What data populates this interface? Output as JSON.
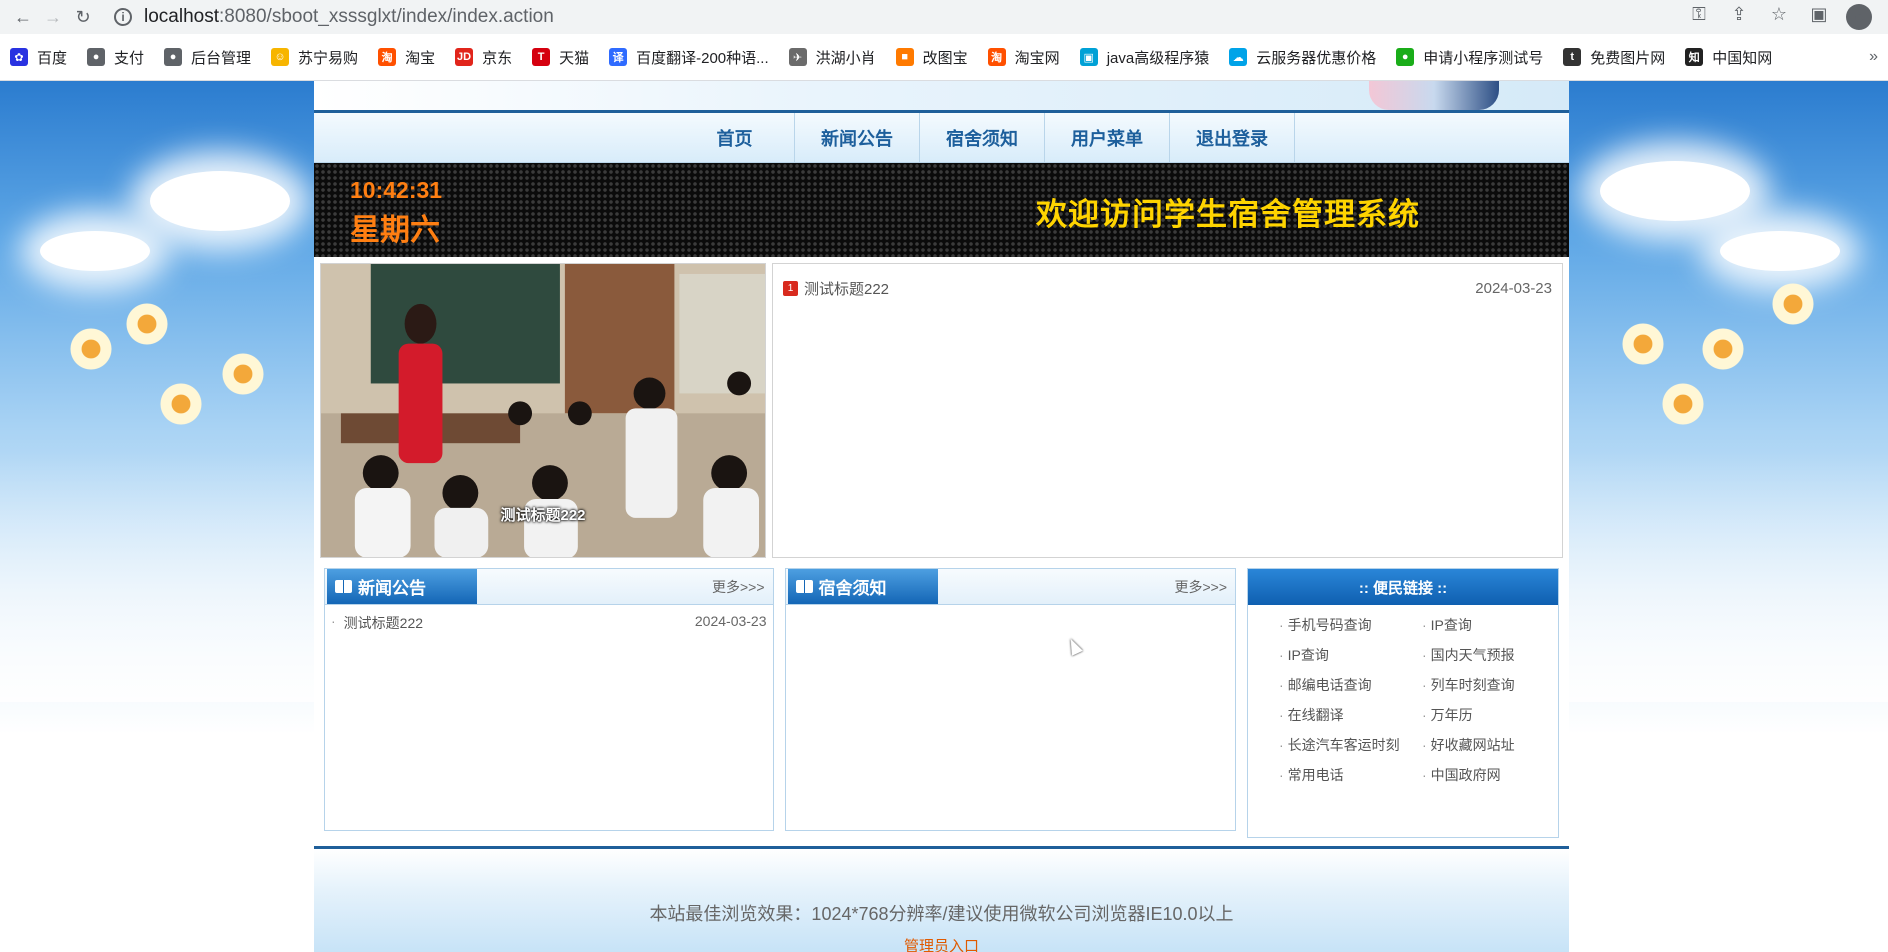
{
  "browser": {
    "url_host": "localhost",
    "url_path": ":8080/sboot_xsssglxt/index/index.action",
    "bookmarks": [
      {
        "label": "百度",
        "icon": "baidu-icon",
        "color": "#2932e1",
        "glyph": "✿"
      },
      {
        "label": "支付",
        "icon": "globe-icon",
        "color": "#5f6368",
        "glyph": "●"
      },
      {
        "label": "后台管理",
        "icon": "globe-icon",
        "color": "#5f6368",
        "glyph": "●"
      },
      {
        "label": "苏宁易购",
        "icon": "suning-icon",
        "color": "#f7b500",
        "glyph": "☺"
      },
      {
        "label": "淘宝",
        "icon": "taobao-icon",
        "color": "#ff5000",
        "glyph": "淘"
      },
      {
        "label": "京东",
        "icon": "jd-icon",
        "color": "#e1251b",
        "glyph": "JD"
      },
      {
        "label": "天猫",
        "icon": "tmall-icon",
        "color": "#d5000f",
        "glyph": "T"
      },
      {
        "label": "百度翻译-200种语...",
        "icon": "translate-icon",
        "color": "#2f6bff",
        "glyph": "译"
      },
      {
        "label": "洪湖小肖",
        "icon": "bird-icon",
        "color": "#6b6b6b",
        "glyph": "✈"
      },
      {
        "label": "改图宝",
        "icon": "gaitubao-icon",
        "color": "#ff7a00",
        "glyph": "■"
      },
      {
        "label": "淘宝网",
        "icon": "taobao-icon",
        "color": "#ff5000",
        "glyph": "淘"
      },
      {
        "label": "java高级程序猿",
        "icon": "bilibili-icon",
        "color": "#00a1d6",
        "glyph": "▣"
      },
      {
        "label": "云服务器优惠价格",
        "icon": "cloud-icon",
        "color": "#00a3e8",
        "glyph": "☁"
      },
      {
        "label": "申请小程序测试号",
        "icon": "wechat-icon",
        "color": "#1aad19",
        "glyph": "●"
      },
      {
        "label": "免费图片网",
        "icon": "t-icon",
        "color": "#333333",
        "glyph": "t"
      },
      {
        "label": "中国知网",
        "icon": "cnki-icon",
        "color": "#222222",
        "glyph": "知"
      }
    ]
  },
  "nav": {
    "items": [
      "首页",
      "新闻公告",
      "宿舍须知",
      "用户菜单",
      "退出登录"
    ]
  },
  "banner": {
    "time": "10:42:31",
    "weekday": "星期六",
    "welcome": "欢迎访问学生宿舍管理系统"
  },
  "slideshow": {
    "caption": "测试标题222"
  },
  "headlines": [
    {
      "badge": "1",
      "title": "测试标题222",
      "date": "2024-03-23"
    }
  ],
  "news_panel": {
    "title": "新闻公告",
    "more": "更多>>>",
    "items": [
      {
        "title": "测试标题222",
        "date": "2024-03-23"
      }
    ]
  },
  "dorm_panel": {
    "title": "宿舍须知",
    "more": "更多>>>"
  },
  "links_panel": {
    "title": ":: 便民链接 ::",
    "links": [
      "手机号码查询",
      "IP查询",
      "IP查询",
      "国内天气预报",
      "邮编电话查询",
      "列车时刻查询",
      "在线翻译",
      "万年历",
      "长途汽车客运时刻",
      "好收藏网站址",
      "常用电话",
      "中国政府网"
    ]
  },
  "footer": {
    "text": "本站最佳浏览效果：1024*768分辨率/建议使用微软公司浏览器IE10.0以上",
    "admin_link": "管理员入口"
  }
}
